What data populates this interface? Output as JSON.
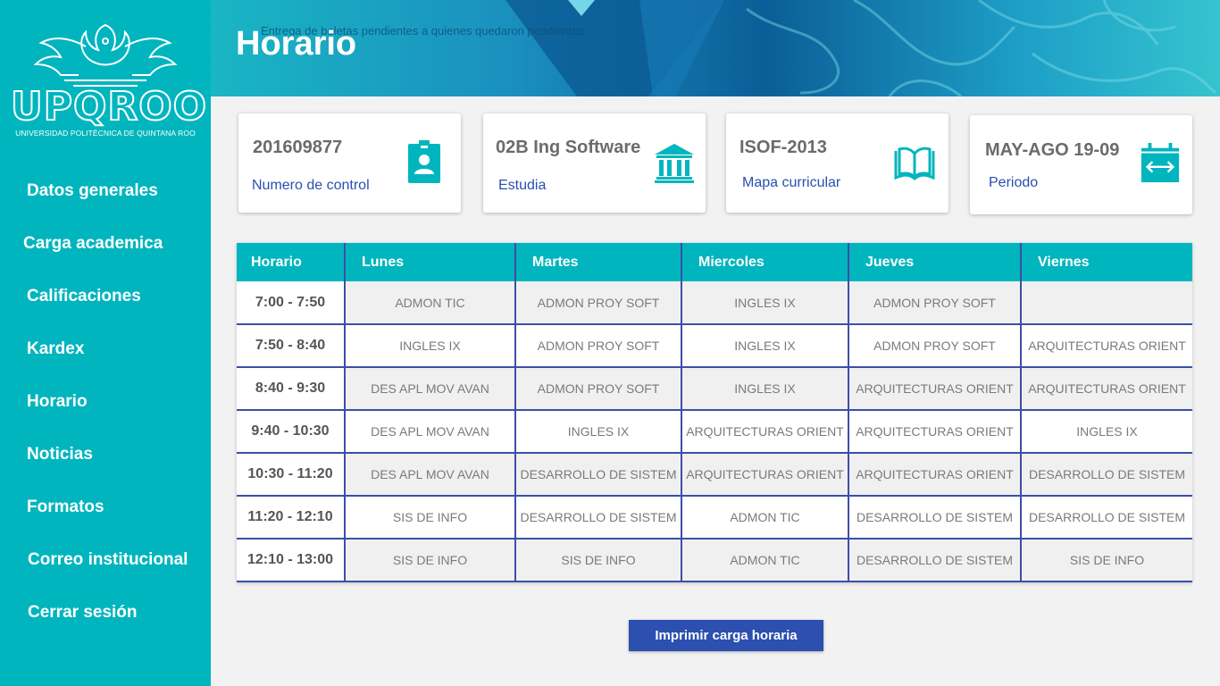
{
  "logo": {
    "wordmark": "UPQROO",
    "subtitle": "UNIVERSIDAD POLITÉCNICA DE QUINTANA ROO"
  },
  "sidebar": {
    "items": [
      {
        "label": "Datos generales"
      },
      {
        "label": "Carga academica"
      },
      {
        "label": "Calificaciones"
      },
      {
        "label": "Kardex"
      },
      {
        "label": "Horario"
      },
      {
        "label": "Noticias"
      },
      {
        "label": "Formatos"
      },
      {
        "label": "Correo institucional"
      },
      {
        "label": "Cerrar sesión"
      }
    ]
  },
  "header": {
    "title": "Horario",
    "marquee": "Entrega de boletas pendientes a quienes quedaron pendientes"
  },
  "cards": [
    {
      "value": "201609877",
      "label": "Numero de control",
      "icon": "id-badge-icon"
    },
    {
      "value": "02B Ing Software",
      "label": "Estudia",
      "icon": "institution-icon"
    },
    {
      "value": "ISOF-2013",
      "label": "Mapa curricular",
      "icon": "open-book-icon"
    },
    {
      "value": "MAY-AGO 19-09",
      "label": "Periodo",
      "icon": "calendar-range-icon"
    }
  ],
  "colors": {
    "accent": "#00b5be",
    "primary": "#2c4fb0",
    "divider": "#3b4fa8"
  },
  "schedule": {
    "headers": [
      "Horario",
      "Lunes",
      "Martes",
      "Miercoles",
      "Jueves",
      "Viernes"
    ],
    "rows": [
      {
        "time": "7:00 - 7:50",
        "cells": [
          "ADMON TIC",
          "ADMON PROY SOFT",
          "INGLES IX",
          "ADMON PROY SOFT",
          ""
        ]
      },
      {
        "time": "7:50 - 8:40",
        "cells": [
          "INGLES IX",
          "ADMON PROY SOFT",
          "INGLES IX",
          "ADMON PROY SOFT",
          "ARQUITECTURAS ORIENT"
        ]
      },
      {
        "time": "8:40 - 9:30",
        "cells": [
          "DES APL MOV AVAN",
          "ADMON PROY SOFT",
          "INGLES IX",
          "ARQUITECTURAS ORIENT",
          "ARQUITECTURAS ORIENT"
        ]
      },
      {
        "time": "9:40 - 10:30",
        "cells": [
          "DES APL MOV AVAN",
          "INGLES IX",
          "ARQUITECTURAS ORIENT",
          "ARQUITECTURAS ORIENT",
          "INGLES IX"
        ]
      },
      {
        "time": "10:30 - 11:20",
        "cells": [
          "DES APL MOV AVAN",
          "DESARROLLO DE SISTEM",
          "ARQUITECTURAS ORIENT",
          "ARQUITECTURAS ORIENT",
          "DESARROLLO DE SISTEM"
        ]
      },
      {
        "time": "11:20 - 12:10",
        "cells": [
          "SIS DE INFO",
          "DESARROLLO DE SISTEM",
          "ADMON TIC",
          "DESARROLLO DE SISTEM",
          "DESARROLLO DE SISTEM"
        ]
      },
      {
        "time": "12:10 - 13:00",
        "cells": [
          "SIS DE INFO",
          "SIS DE INFO",
          "ADMON TIC",
          "DESARROLLO DE SISTEM",
          "SIS DE INFO"
        ]
      }
    ]
  },
  "actions": {
    "print_label": "Imprimir carga horaria"
  }
}
